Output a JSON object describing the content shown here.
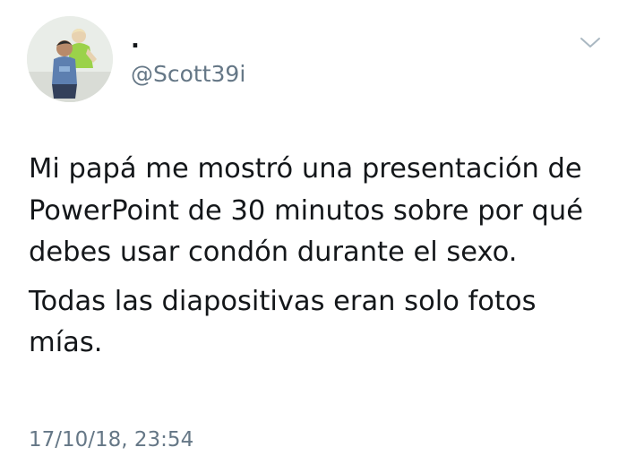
{
  "tweet": {
    "author": {
      "display_name": ".",
      "handle": "@Scott39i",
      "avatar_icon": "profile-photo"
    },
    "menu_icon": "chevron-down-icon",
    "paragraphs": [
      "Mi papá me mostró una presentación de PowerPoint de 30 minutos sobre por qué debes usar condón durante el sexo.",
      "Todas las diapositivas eran solo fotos mías."
    ],
    "timestamp": "17/10/18, 23:54"
  },
  "colors": {
    "text": "#14171a",
    "secondary_text": "#657786",
    "background": "#ffffff"
  }
}
